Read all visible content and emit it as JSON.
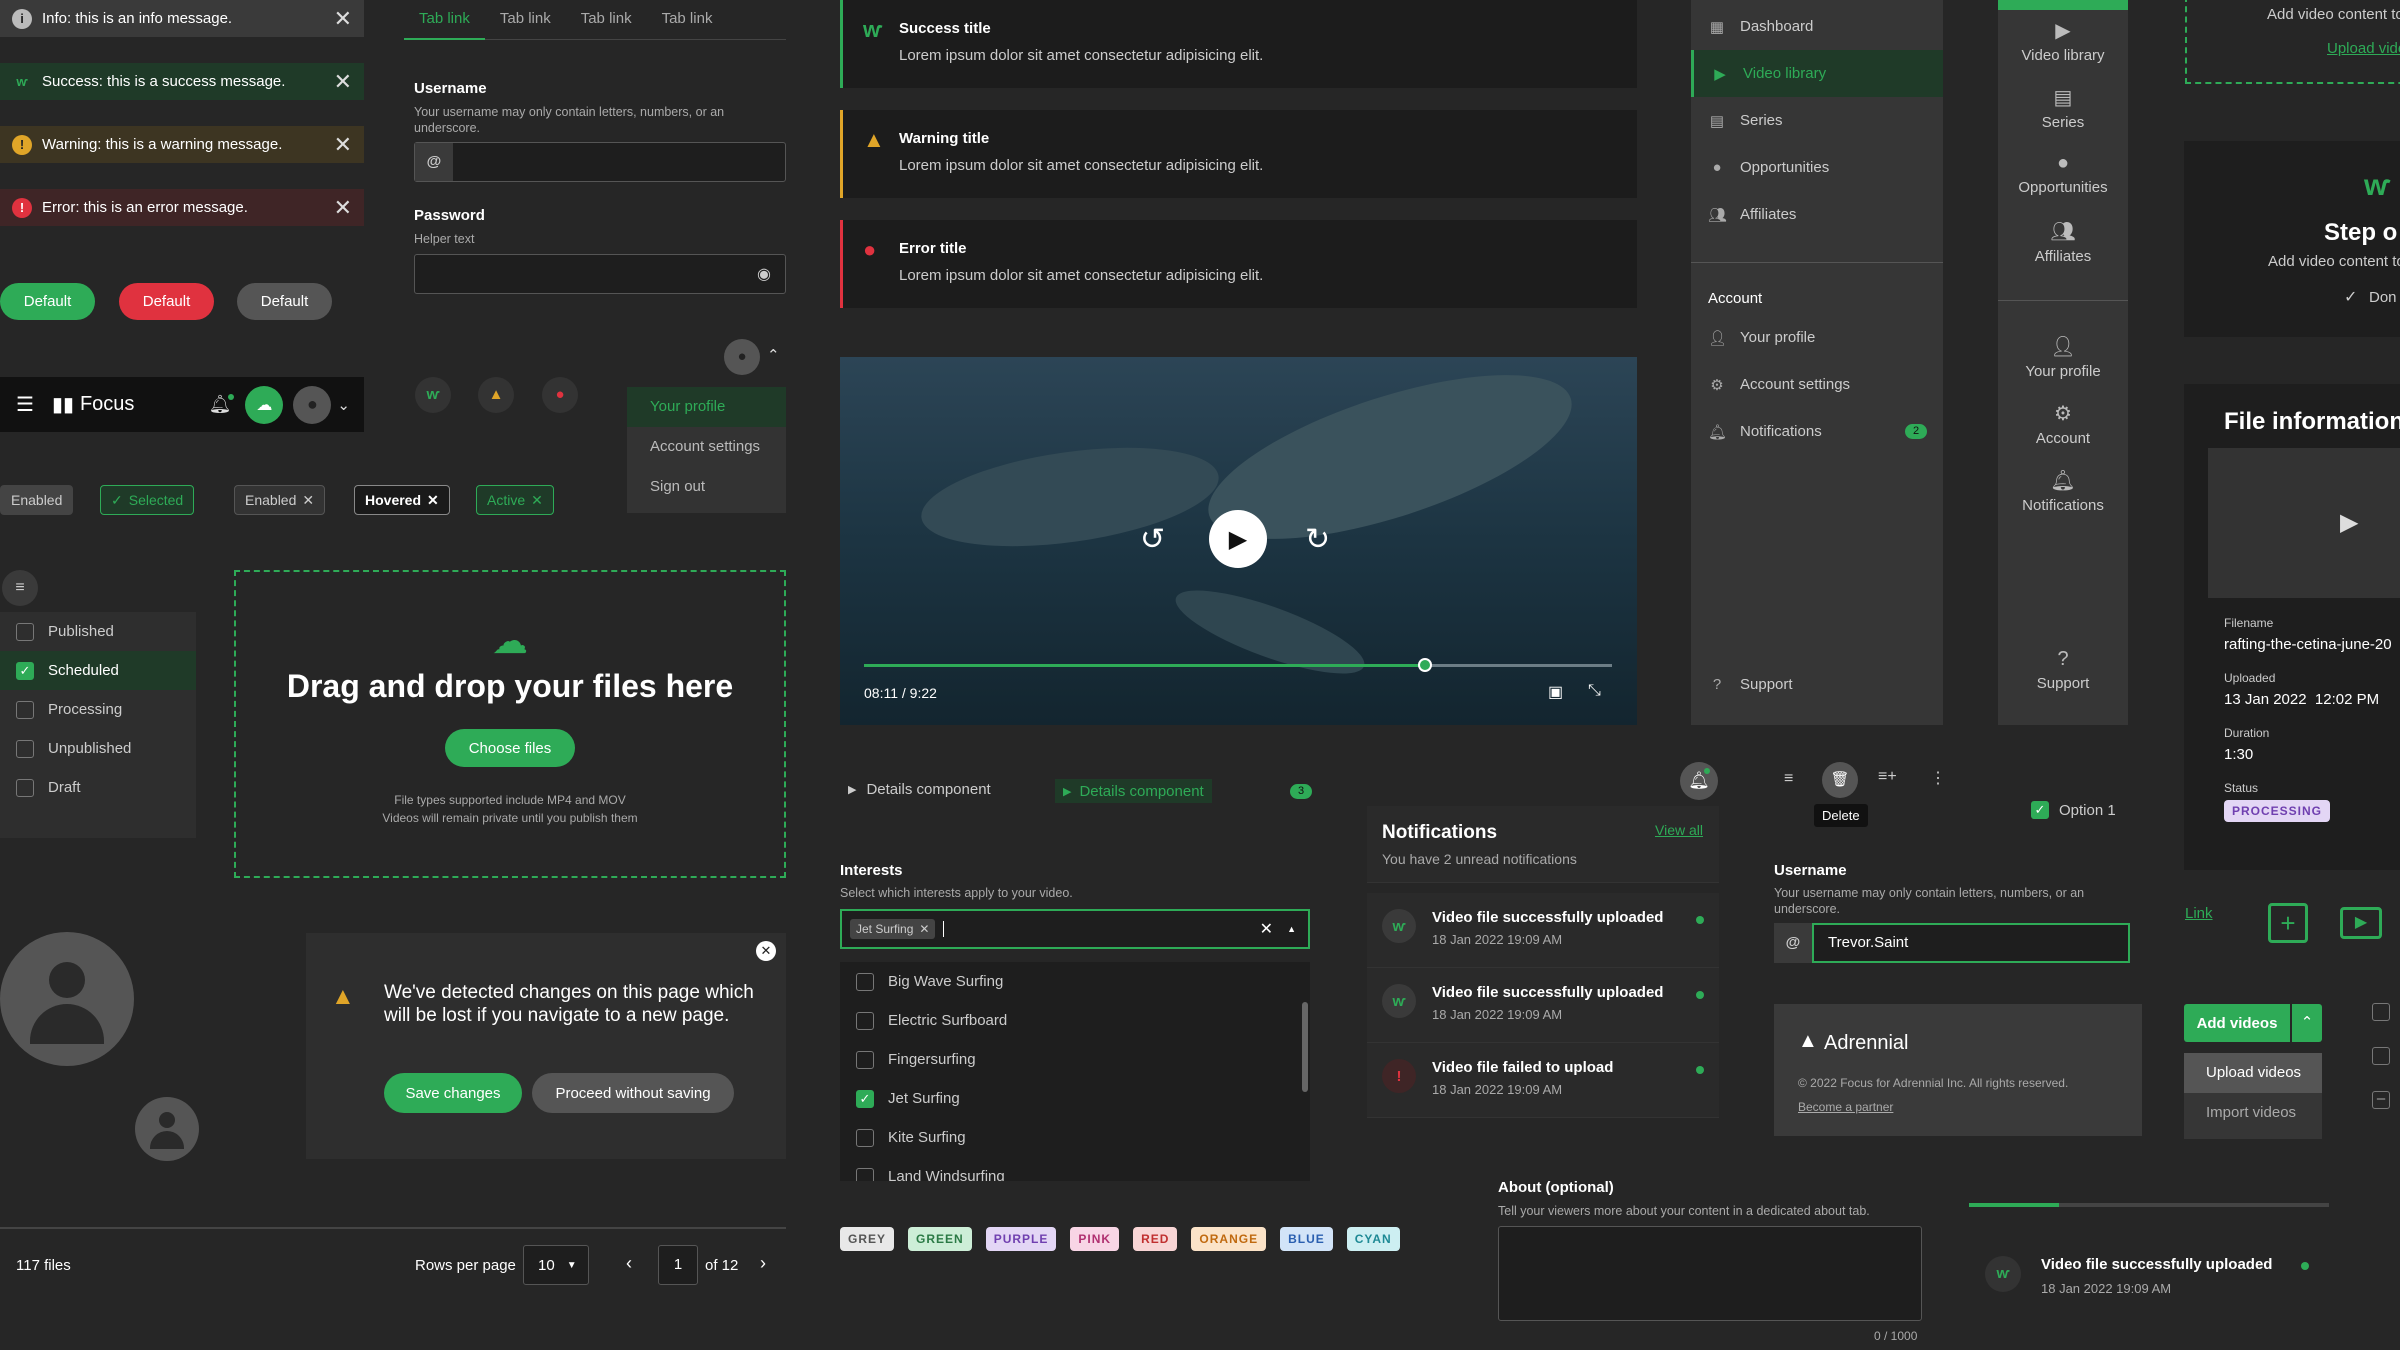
{
  "alerts": [
    {
      "type": "info",
      "text": "Info: this is an info message.",
      "color": "#3a3a3a",
      "icon": "info-icon"
    },
    {
      "type": "success",
      "text": "Success: this is a success message.",
      "color": "#1f3a28",
      "icon": "success-icon"
    },
    {
      "type": "warning",
      "text": "Warning: this is a warning message.",
      "color": "#3d3522",
      "icon": "warning-icon"
    },
    {
      "type": "error",
      "text": "Error: this is an error message.",
      "color": "#3f2526",
      "icon": "error-icon"
    }
  ],
  "buttons": {
    "green": "Default",
    "red": "Default",
    "grey": "Default"
  },
  "topbar": {
    "app_name": "Focus"
  },
  "chips": [
    "Enabled",
    "Selected",
    "Enabled",
    "Hovered",
    "Active"
  ],
  "filters": [
    "Published",
    "Scheduled",
    "Processing",
    "Unpublished",
    "Draft"
  ],
  "tabs": [
    "Tab link",
    "Tab link",
    "Tab link",
    "Tab link"
  ],
  "form": {
    "username_label": "Username",
    "username_help": "Your username may only contain letters, numbers, or an underscore.",
    "password_label": "Password",
    "password_help": "Helper text"
  },
  "profile_menu": [
    "Your profile",
    "Account settings",
    "Sign out"
  ],
  "dropzone": {
    "title": "Drag and drop your files here",
    "button": "Choose files",
    "note1": "File types supported include MP4 and MOV",
    "note2": "Videos will remain private until you publish them"
  },
  "dialog": {
    "message": "We've detected changes on this page which will be lost if you navigate to a new page.",
    "save": "Save changes",
    "proceed": "Proceed without saving"
  },
  "pagination": {
    "count": "117 files",
    "rows_label": "Rows per page",
    "rows_value": "10",
    "page": "1",
    "of": "of 12"
  },
  "alert_boxes": [
    {
      "title": "Success title",
      "desc": "Lorem ipsum dolor sit amet consectetur adipisicing elit.",
      "color": "#2eab57"
    },
    {
      "title": "Warning title",
      "desc": "Lorem ipsum dolor sit amet consectetur adipisicing elit.",
      "color": "#e0a528"
    },
    {
      "title": "Error title",
      "desc": "Lorem ipsum dolor sit amet consectetur adipisicing elit.",
      "color": "#e0323f"
    }
  ],
  "video": {
    "time": "08:11 / 9:22",
    "progress": 0.75
  },
  "details": {
    "label1": "Details component",
    "label2": "Details component",
    "badge": "3"
  },
  "interests": {
    "label": "Interests",
    "help": "Select which interests apply to your video.",
    "selected_chip": "Jet Surfing",
    "options": [
      {
        "label": "Big Wave Surfing",
        "checked": false
      },
      {
        "label": "Electric Surfboard",
        "checked": false
      },
      {
        "label": "Fingersurfing",
        "checked": false
      },
      {
        "label": "Jet Surfing",
        "checked": true
      },
      {
        "label": "Kite Surfing",
        "checked": false
      },
      {
        "label": "Land Windsurfing",
        "checked": false
      }
    ]
  },
  "tags": [
    {
      "label": "GREY",
      "bg": "#e8e8e8",
      "fg": "#555"
    },
    {
      "label": "GREEN",
      "bg": "#cdeed7",
      "fg": "#2b7a45"
    },
    {
      "label": "PURPLE",
      "bg": "#e3d6f5",
      "fg": "#7040b0"
    },
    {
      "label": "PINK",
      "bg": "#f8d5e5",
      "fg": "#b03070"
    },
    {
      "label": "RED",
      "bg": "#f8d5d5",
      "fg": "#c03030"
    },
    {
      "label": "ORANGE",
      "bg": "#fbe3c8",
      "fg": "#c06a10"
    },
    {
      "label": "BLUE",
      "bg": "#d2e4f8",
      "fg": "#2a5fb0"
    },
    {
      "label": "CYAN",
      "bg": "#cdeff2",
      "fg": "#1e8a95"
    }
  ],
  "notifications": {
    "title": "Notifications",
    "view_all": "View all",
    "subtitle": "You have 2 unread notifications",
    "items": [
      {
        "title": "Video file successfully uploaded",
        "time": "18 Jan 2022 19:09 AM",
        "type": "success"
      },
      {
        "title": "Video file successfully uploaded",
        "time": "18 Jan 2022 19:09 AM",
        "type": "success"
      },
      {
        "title": "Video file failed to upload",
        "time": "18 Jan 2022 19:09 AM",
        "type": "error"
      }
    ]
  },
  "about": {
    "label": "About (optional)",
    "help": "Tell your viewers more about your content in a dedicated about tab.",
    "counter": "0 / 1000"
  },
  "sidebar": {
    "items": [
      "Dashboard",
      "Video library",
      "Series",
      "Opportunities",
      "Affiliates"
    ],
    "account_heading": "Account",
    "account_items": [
      "Your profile",
      "Account settings",
      "Notifications"
    ],
    "badge": "2",
    "support": "Support"
  },
  "rail": {
    "items": [
      "Video library",
      "Series",
      "Opportunities",
      "Affiliates"
    ],
    "account_items": [
      "Your profile",
      "Account",
      "Notifications"
    ],
    "support": "Support"
  },
  "toolbar": {
    "tooltip": "Delete"
  },
  "option1": "Option 1",
  "username2": {
    "label": "Username",
    "help": "Your username may only contain letters, numbers, or an underscore.",
    "value": "Trevor.Saint"
  },
  "footer": {
    "brand": "Adrennial",
    "copyright": "© 2022 Focus for Adrennial Inc. All rights reserved.",
    "link": "Become a partner"
  },
  "link_text": "Link",
  "add_videos": {
    "label": "Add videos",
    "menu": [
      "Upload videos",
      "Import videos"
    ]
  },
  "upload_card": {
    "text": "Add video content to",
    "link": "Upload vide"
  },
  "step_card": {
    "title": "Step o",
    "text": "Add video content to",
    "done": "Don"
  },
  "file_info": {
    "title": "File information",
    "filename_label": "Filename",
    "filename": "rafting-the-cetina-june-20",
    "uploaded_label": "Uploaded",
    "uploaded": "13 Jan 2022  12:02 PM",
    "duration_label": "Duration",
    "duration": "1:30",
    "status_label": "Status",
    "status": "PROCESSING"
  },
  "toast": {
    "title": "Video file successfully uploaded",
    "time": "18 Jan 2022 19:09 AM"
  }
}
